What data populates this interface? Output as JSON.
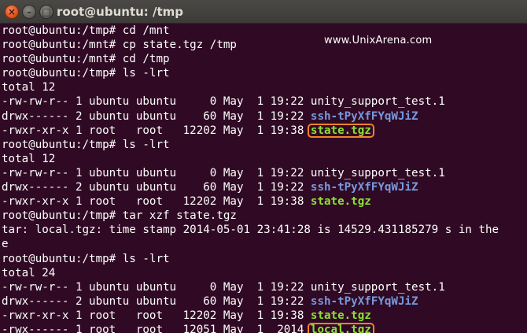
{
  "window": {
    "title": "root@ubuntu: /tmp",
    "buttons": {
      "close": "×",
      "minimize": "–",
      "maximize": "□"
    }
  },
  "watermark": "www.UnixArena.com",
  "lines": [
    {
      "prompt": "root@ubuntu:/tmp# ",
      "cmd": "cd /mnt"
    },
    {
      "prompt": "root@ubuntu:/mnt# ",
      "cmd": "cp state.tgz /tmp"
    },
    {
      "prompt": "root@ubuntu:/mnt# ",
      "cmd": "cd /tmp"
    },
    {
      "prompt": "root@ubuntu:/tmp# ",
      "cmd": "ls -lrt"
    },
    {
      "text": "total 12"
    },
    {
      "meta": "-rw-rw-r-- 1 ubuntu ubuntu     0 May  1 19:22 ",
      "name": "unity_support_test.1",
      "kind": "file"
    },
    {
      "meta": "drwx------ 2 ubuntu ubuntu    60 May  1 19:22 ",
      "name": "ssh-tPyXfFYqWJiZ",
      "kind": "dir"
    },
    {
      "meta": "-rwxr-xr-x 1 root   root   12202 May  1 19:38 ",
      "name": "state.tgz",
      "kind": "exe",
      "highlight": true
    },
    {
      "prompt": "root@ubuntu:/tmp# ",
      "cmd": "ls -lrt"
    },
    {
      "text": "total 12"
    },
    {
      "meta": "-rw-rw-r-- 1 ubuntu ubuntu     0 May  1 19:22 ",
      "name": "unity_support_test.1",
      "kind": "file"
    },
    {
      "meta": "drwx------ 2 ubuntu ubuntu    60 May  1 19:22 ",
      "name": "ssh-tPyXfFYqWJiZ",
      "kind": "dir"
    },
    {
      "meta": "-rwxr-xr-x 1 root   root   12202 May  1 19:38 ",
      "name": "state.tgz",
      "kind": "exe"
    },
    {
      "prompt": "root@ubuntu:/tmp# ",
      "cmd": "tar xzf state.tgz"
    },
    {
      "text": "tar: local.tgz: time stamp 2014-05-01 23:41:28 is 14529.431185279 s in the"
    },
    {
      "text": "e"
    },
    {
      "prompt": "root@ubuntu:/tmp# ",
      "cmd": "ls -lrt"
    },
    {
      "text": "total 24"
    },
    {
      "meta": "-rw-rw-r-- 1 ubuntu ubuntu     0 May  1 19:22 ",
      "name": "unity_support_test.1",
      "kind": "file"
    },
    {
      "meta": "drwx------ 2 ubuntu ubuntu    60 May  1 19:22 ",
      "name": "ssh-tPyXfFYqWJiZ",
      "kind": "dir"
    },
    {
      "meta": "-rwxr-xr-x 1 root   root   12202 May  1 19:38 ",
      "name": "state.tgz",
      "kind": "exe"
    },
    {
      "meta": "-rwx------ 1 root   root   12051 May  1  2014 ",
      "name": "local.tgz",
      "kind": "exe",
      "highlight": true
    }
  ],
  "colors": {
    "background": "#300a24",
    "directory": "#7799dd",
    "executable": "#8ae234",
    "highlight_box": "#f0822a"
  }
}
